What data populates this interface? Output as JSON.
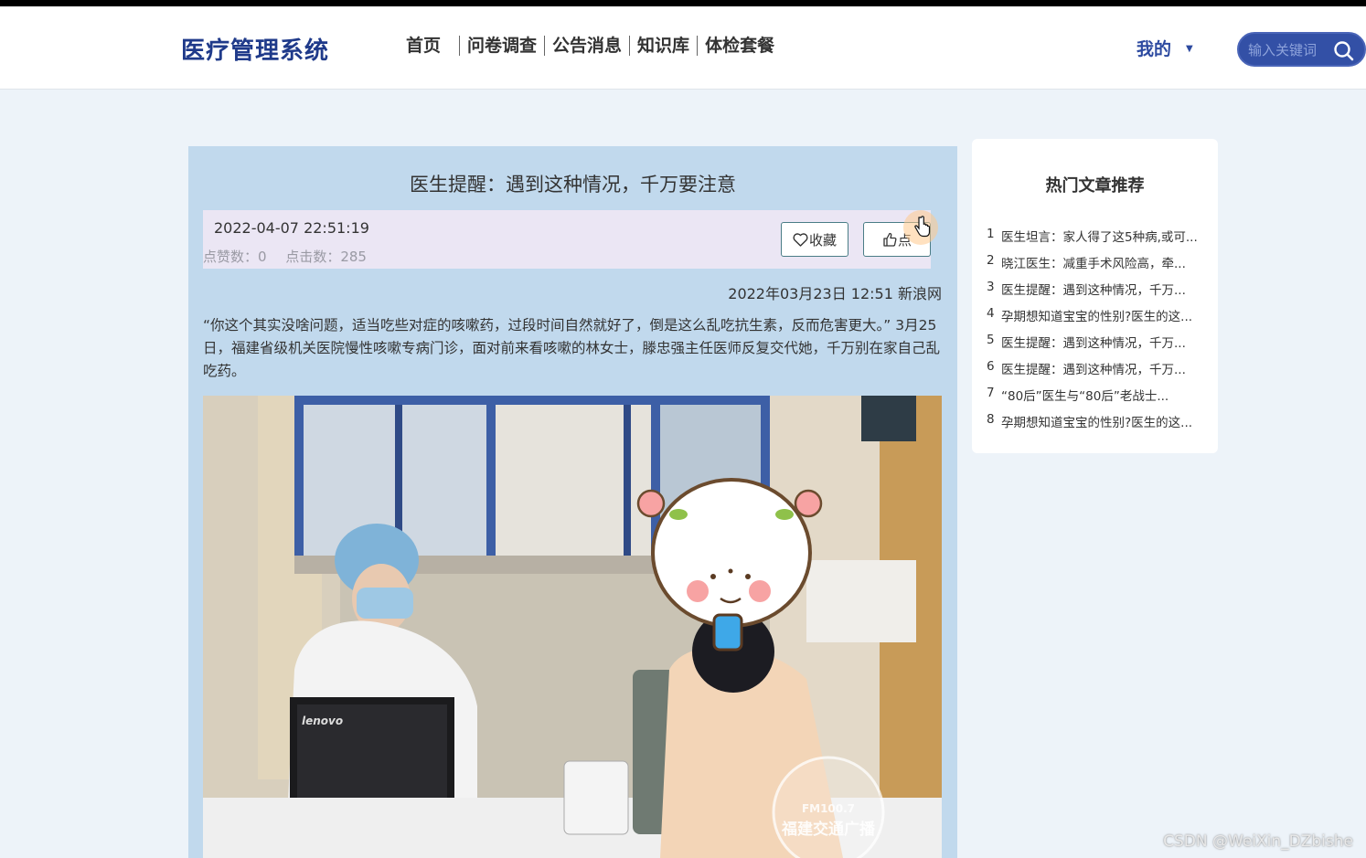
{
  "header": {
    "logo": "医疗管理系统",
    "nav": [
      "首页",
      "问卷调查",
      "公告消息",
      "知识库",
      "体检套餐"
    ],
    "my_label": "我的",
    "search_placeholder": "输入关键词"
  },
  "article": {
    "title": "医生提醒：遇到这种情况，千万要注意",
    "date": "2022-04-07 22:51:19",
    "likes_label": "点赞数：0",
    "clicks_label": "点击数：285",
    "fav_button": "收藏",
    "like_button": "点",
    "source": "2022年03月23日 12:51 新浪网",
    "body": "“你这个其实没啥问题，适当吃些对症的咳嗽药，过段时间自然就好了，倒是这么乱吃抗生素，反而危害更大。” 3月25日，福建省级机关医院慢性咳嗽专病门诊，面对前来看咳嗽的林女士，滕忠强主任医师反复交代她，千万别在家自己乱吃药。",
    "photo_stamp_line1": "FM100.7",
    "photo_stamp_line2": "福建交通广播",
    "photo_monitor_brand": "lenovo"
  },
  "sidebar": {
    "title": "热门文章推荐",
    "items": [
      {
        "num": "1",
        "text": "医生坦言：家人得了这5种病,或可..."
      },
      {
        "num": "2",
        "text": "晓江医生：减重手术风险高，牵..."
      },
      {
        "num": "3",
        "text": "医生提醒：遇到这种情况，千万..."
      },
      {
        "num": "4",
        "text": "孕期想知道宝宝的性别?医生的这..."
      },
      {
        "num": "5",
        "text": "医生提醒：遇到这种情况，千万..."
      },
      {
        "num": "6",
        "text": "医生提醒：遇到这种情况，千万..."
      },
      {
        "num": "7",
        "text": "“80后”医生与“80后”老战士..."
      },
      {
        "num": "8",
        "text": "孕期想知道宝宝的性别?医生的这..."
      }
    ]
  },
  "watermark": "CSDN @WeiXin_DZbishe",
  "colors": {
    "brand": "#1f3a8a",
    "search_bg": "#3350a6",
    "article_bg": "#c1d9ed",
    "meta_bg": "#ebe6f4",
    "page_bg": "#edf3f9"
  }
}
